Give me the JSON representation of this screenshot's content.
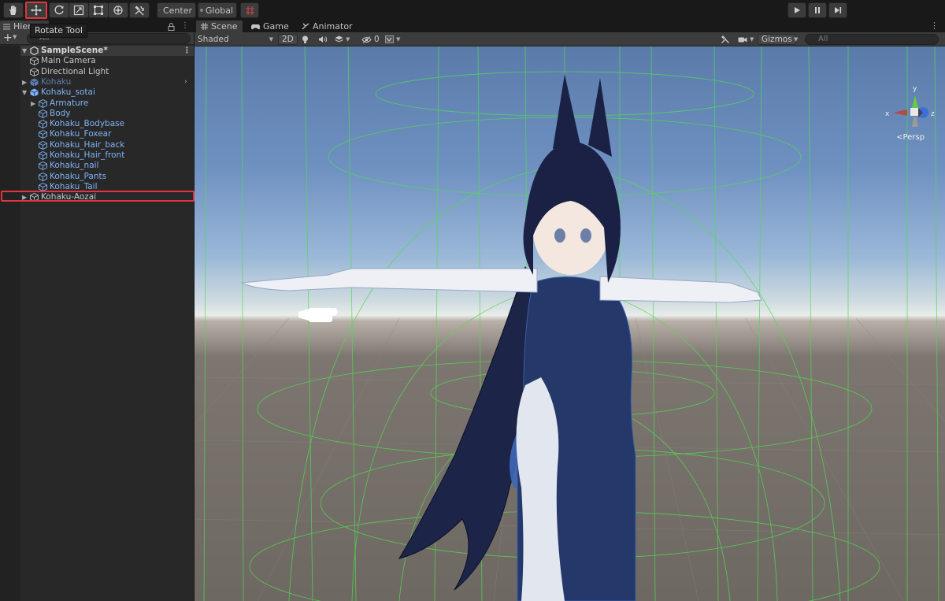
{
  "toolbar": {
    "tools": [
      {
        "name": "hand-tool",
        "icon": "hand-icon"
      },
      {
        "name": "move-tool",
        "icon": "move-icon"
      },
      {
        "name": "rotate-tool",
        "icon": "rotate-icon"
      },
      {
        "name": "scale-tool",
        "icon": "scale-icon"
      },
      {
        "name": "rect-tool",
        "icon": "rect-icon"
      },
      {
        "name": "transform-tool",
        "icon": "transform-icon"
      },
      {
        "name": "custom-tool",
        "icon": "custom-tools-icon"
      }
    ],
    "pivot_label": "Center",
    "space_label": "Global",
    "snap_icon": "grid-snap-icon",
    "tooltip": "Rotate Tool",
    "play_icon": "play-icon",
    "pause_icon": "pause-icon",
    "step_icon": "step-icon"
  },
  "hierarchy": {
    "tab_label": "Hiera",
    "search_placeholder": "All",
    "scene_name": "SampleScene*",
    "items": [
      {
        "label": "Main Camera",
        "type": "object"
      },
      {
        "label": "Directional Light",
        "type": "object"
      },
      {
        "label": "Kohaku",
        "type": "prefab-dim"
      },
      {
        "label": "Kohaku_sotai",
        "type": "prefab"
      },
      {
        "label": "Armature",
        "type": "prefab"
      },
      {
        "label": "Body",
        "type": "prefab"
      },
      {
        "label": "Kohaku_Bodybase",
        "type": "prefab"
      },
      {
        "label": "Kohaku_Foxear",
        "type": "prefab"
      },
      {
        "label": "Kohaku_Hair_back",
        "type": "prefab"
      },
      {
        "label": "Kohaku_Hair_front",
        "type": "prefab"
      },
      {
        "label": "Kohaku_nail",
        "type": "prefab"
      },
      {
        "label": "Kohaku_Pants",
        "type": "prefab"
      },
      {
        "label": "Kohaku_Tail",
        "type": "prefab"
      },
      {
        "label": "Kohaku-Aozai",
        "type": "object"
      }
    ]
  },
  "scene": {
    "tabs": [
      {
        "label": "Scene",
        "icon": "grid-icon"
      },
      {
        "label": "Game",
        "icon": "gamepad-icon"
      },
      {
        "label": "Animator",
        "icon": "animator-icon"
      }
    ],
    "shading_mode": "Shaded",
    "mode_2d": "2D",
    "hidden_count": "0",
    "gizmos_label": "Gizmos",
    "search_placeholder": "All",
    "projection_label": "Persp",
    "axis_labels": {
      "x": "x",
      "y": "y",
      "z": "z"
    }
  },
  "colors": {
    "selection_highlight": "#e2353f",
    "prefab_text": "#7fb3f5",
    "collider_wire": "#4fdc4f"
  }
}
